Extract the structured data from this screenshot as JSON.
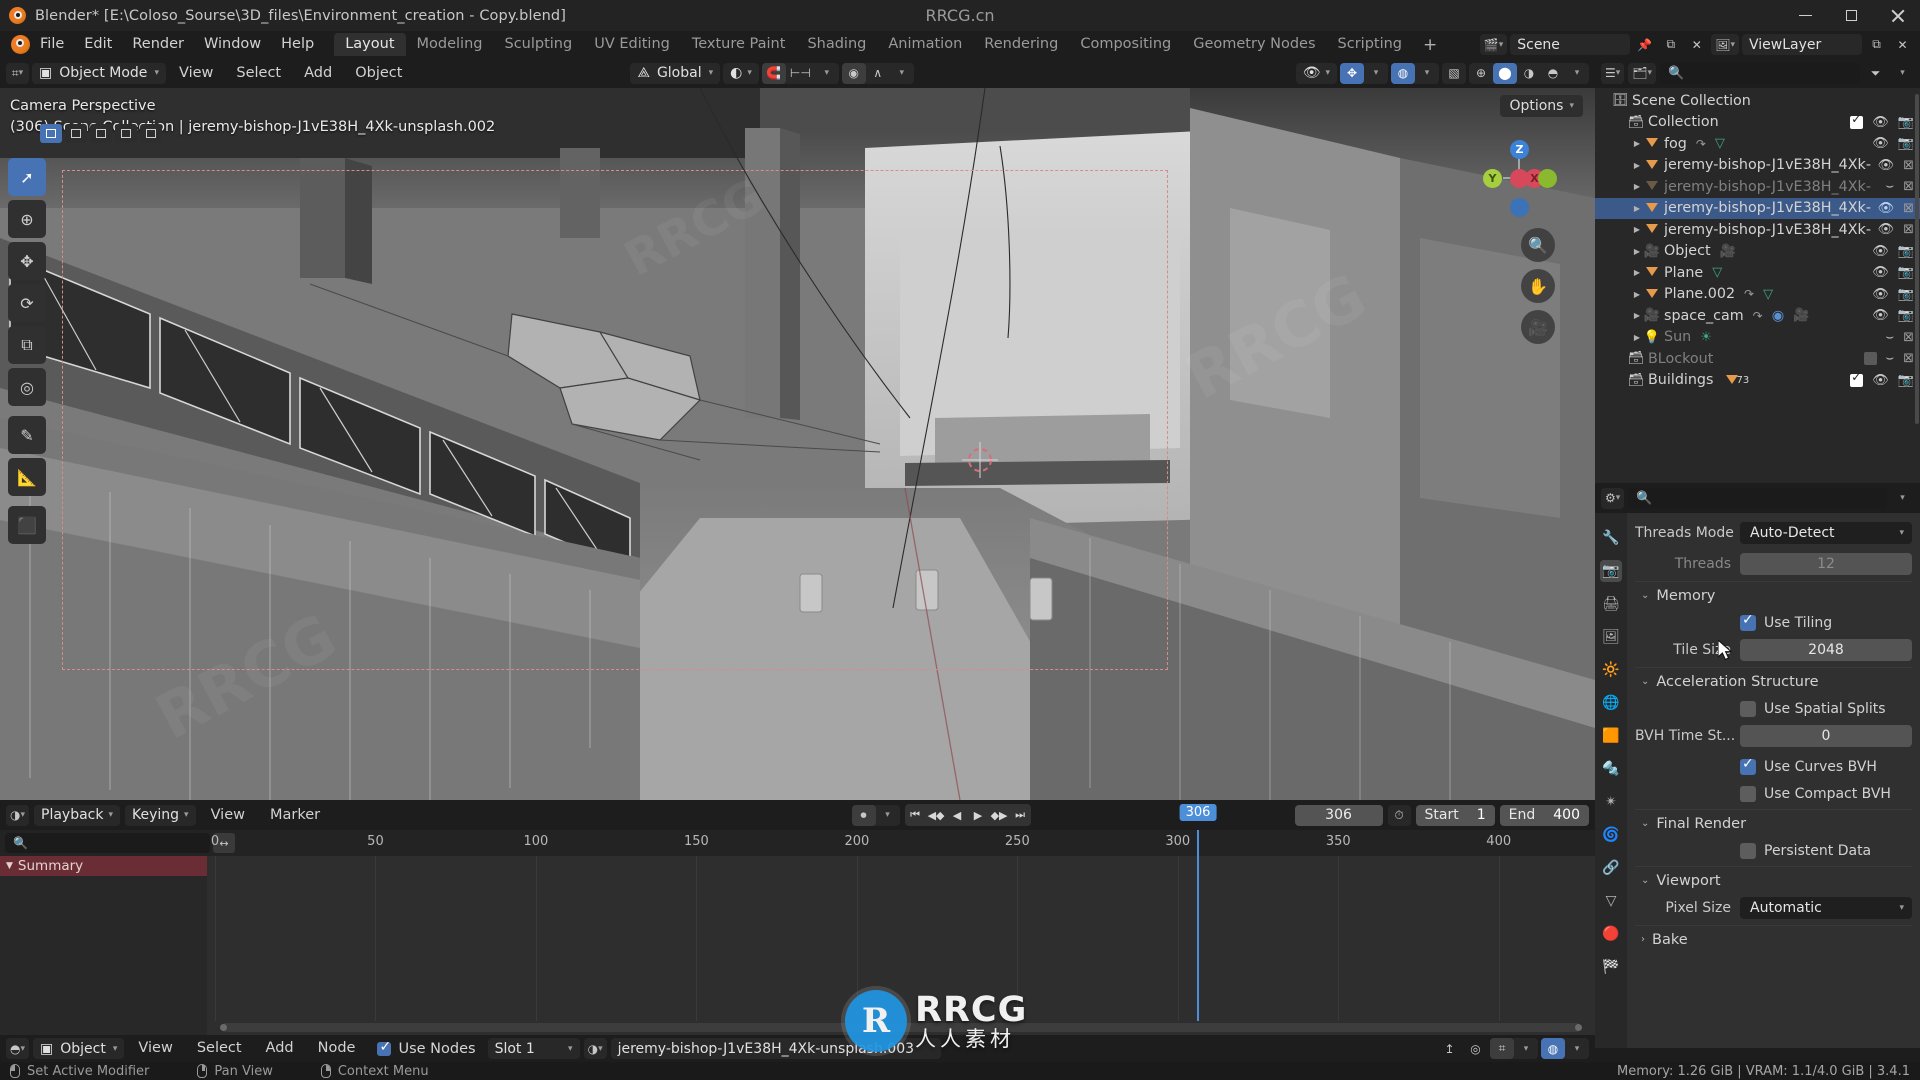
{
  "window": {
    "title": "Blender* [E:\\Coloso_Sourse\\3D_files\\Environment_creation - Copy.blend]",
    "center_watermark": "RRCG.cn",
    "minimize": "–",
    "maximize": "□",
    "close": "✕"
  },
  "menus": [
    "File",
    "Edit",
    "Render",
    "Window",
    "Help"
  ],
  "workspaces": {
    "tabs": [
      "Layout",
      "Modeling",
      "Sculpting",
      "UV Editing",
      "Texture Paint",
      "Shading",
      "Animation",
      "Rendering",
      "Compositing",
      "Geometry Nodes",
      "Scripting"
    ],
    "active": "Layout",
    "add": "+"
  },
  "topbar_right": {
    "scene_icon": "scene-icon",
    "scene_name": "Scene",
    "viewlayer_icon": "viewlayer-icon",
    "viewlayer_name": "ViewLayer"
  },
  "viewport": {
    "mode": "Object Mode",
    "menus": [
      "View",
      "Select",
      "Add",
      "Object"
    ],
    "transform_orientation": "Global",
    "options_label": "Options",
    "overlay_line1": "Camera Perspective",
    "overlay_line2": "(306) Scene Collection | jeremy-bishop-J1vE38H_4Xk-unsplash.002",
    "gizmo_axes": [
      "X",
      "Y",
      "Z"
    ]
  },
  "outliner": {
    "search_placeholder": "",
    "rows": [
      {
        "label": "Scene Collection",
        "icon": "scene-collection-icon",
        "indent": 0,
        "disclosure": false,
        "checkbox": null,
        "eye": false,
        "camera": false,
        "selected": false,
        "dim": false
      },
      {
        "label": "Collection",
        "icon": "collection-icon",
        "indent": 1,
        "disclosure": false,
        "checkbox": true,
        "eye": true,
        "camera": true,
        "selected": false,
        "dim": false
      },
      {
        "label": "fog",
        "icon": "mesh-object-icon",
        "indent": 2,
        "disclosure": true,
        "checkbox": null,
        "eye": true,
        "camera": true,
        "selected": false,
        "dim": false,
        "extra": [
          "modifier-icon",
          "mesh-data-icon"
        ]
      },
      {
        "label": "jeremy-bishop-J1vE38H_4Xk-",
        "icon": "mesh-object-icon",
        "indent": 2,
        "disclosure": true,
        "checkbox": null,
        "eye": true,
        "camera": "disabled",
        "selected": false,
        "dim": false
      },
      {
        "label": "jeremy-bishop-J1vE38H_4Xk-",
        "icon": "mesh-object-icon",
        "indent": 2,
        "disclosure": true,
        "checkbox": null,
        "eye": "closed",
        "camera": "disabled",
        "selected": false,
        "dim": true
      },
      {
        "label": "jeremy-bishop-J1vE38H_4Xk-",
        "icon": "mesh-object-icon",
        "indent": 2,
        "disclosure": true,
        "checkbox": null,
        "eye": true,
        "camera": "disabled",
        "selected": true,
        "dim": false
      },
      {
        "label": "jeremy-bishop-J1vE38H_4Xk-",
        "icon": "mesh-object-icon",
        "indent": 2,
        "disclosure": true,
        "checkbox": null,
        "eye": true,
        "camera": "disabled",
        "selected": false,
        "dim": false
      },
      {
        "label": "Object",
        "icon": "camera-object-icon",
        "indent": 2,
        "disclosure": true,
        "checkbox": null,
        "eye": true,
        "camera": true,
        "selected": false,
        "dim": false,
        "extra": [
          "camera-data-icon"
        ]
      },
      {
        "label": "Plane",
        "icon": "mesh-object-icon",
        "indent": 2,
        "disclosure": true,
        "checkbox": null,
        "eye": true,
        "camera": true,
        "selected": false,
        "dim": false,
        "extra": [
          "mesh-data-icon"
        ]
      },
      {
        "label": "Plane.002",
        "icon": "mesh-object-icon",
        "indent": 2,
        "disclosure": true,
        "checkbox": null,
        "eye": true,
        "camera": true,
        "selected": false,
        "dim": false,
        "extra": [
          "modifier-icon",
          "mesh-data-icon"
        ]
      },
      {
        "label": "space_cam",
        "icon": "camera-object-icon",
        "indent": 2,
        "disclosure": true,
        "checkbox": null,
        "eye": true,
        "camera": true,
        "selected": false,
        "dim": false,
        "extra": [
          "modifier-icon",
          "constraint-icon",
          "camera-data-icon"
        ]
      },
      {
        "label": "Sun",
        "icon": "light-object-icon",
        "indent": 2,
        "disclosure": true,
        "checkbox": null,
        "eye": "closed",
        "camera": "disabled",
        "selected": false,
        "dim": true,
        "extra": [
          "light-data-icon"
        ]
      },
      {
        "label": "BLockout",
        "icon": "collection-icon",
        "indent": 1,
        "disclosure": false,
        "checkbox": "off",
        "eye": "closed",
        "camera": "disabled",
        "selected": false,
        "dim": true
      },
      {
        "label": "Buildings",
        "icon": "collection-icon",
        "indent": 1,
        "disclosure": false,
        "checkbox": true,
        "eye": true,
        "camera": true,
        "selected": false,
        "dim": false,
        "count": "73"
      }
    ]
  },
  "properties": {
    "search_placeholder": "",
    "tabs": [
      "tool-icon",
      "render-icon",
      "output-icon",
      "viewlayer-icon",
      "scene-icon",
      "world-icon",
      "collection-icon",
      "object-icon",
      "modifier-icon",
      "particles-icon",
      "physics-icon",
      "constraint-icon",
      "data-icon",
      "material-icon",
      "texture-icon"
    ],
    "active_tab_index": 1,
    "performance": {
      "threads_mode_label": "Threads Mode",
      "threads_mode_value": "Auto-Detect",
      "threads_label": "Threads",
      "threads_value": "12"
    },
    "memory": {
      "section": "Memory",
      "use_tiling_label": "Use Tiling",
      "use_tiling_checked": true,
      "tile_size_label": "Tile Size",
      "tile_size_value": "2048"
    },
    "acceleration": {
      "section": "Acceleration Structure",
      "use_spatial_splits_label": "Use Spatial Splits",
      "use_spatial_splits_checked": false,
      "bvh_time_label": "BVH Time St...",
      "bvh_time_value": "0",
      "use_curves_bvh_label": "Use Curves BVH",
      "use_curves_bvh_checked": true,
      "use_compact_bvh_label": "Use Compact BVH",
      "use_compact_bvh_checked": false
    },
    "final_render": {
      "section": "Final Render",
      "persistent_data_label": "Persistent Data",
      "persistent_data_checked": false
    },
    "viewport_sect": {
      "section": "Viewport",
      "pixel_size_label": "Pixel Size",
      "pixel_size_value": "Automatic"
    },
    "bake": {
      "section": "Bake"
    }
  },
  "timeline": {
    "editor_icon": "timeline-icon",
    "menus": [
      "Playback",
      "Keying",
      "View",
      "Marker"
    ],
    "current_frame": "306",
    "start_label": "Start",
    "start_value": "1",
    "end_label": "End",
    "end_value": "400",
    "playhead_label": "306",
    "summary_label": "Summary",
    "ticks": [
      "0",
      "50",
      "100",
      "150",
      "200",
      "250",
      "300",
      "350",
      "400"
    ],
    "tick_values": [
      0,
      50,
      100,
      150,
      200,
      250,
      300,
      350,
      400
    ],
    "search_placeholder": ""
  },
  "shader_editor": {
    "editor_icon": "shader-editor-icon",
    "shader_type": "Object",
    "menus": [
      "View",
      "Select",
      "Add",
      "Node"
    ],
    "use_nodes_label": "Use Nodes",
    "use_nodes_checked": true,
    "slot": "Slot 1",
    "material_name": "jeremy-bishop-J1vE38H_4Xk-unsplash.003"
  },
  "statusbar": {
    "items": [
      {
        "mouse": "left",
        "label": "Set Active Modifier"
      },
      {
        "mouse": "middle",
        "label": "Pan View"
      },
      {
        "mouse": "right",
        "label": "Context Menu"
      }
    ],
    "stats": "Memory: 1.26 GiB | VRAM: 1.1/4.0 GiB | 3.4.1"
  },
  "watermark": {
    "brand": "RRCG",
    "sub": "人人素材",
    "mark": "R",
    "diag": "RRCG"
  },
  "colors": {
    "accent_blue": "#4772b3",
    "select_blue": "#3b5a89",
    "playhead": "#4c8fd8",
    "orange": "#e79a4a",
    "mesh_green": "#3fa882",
    "summary_red": "#6b2d35"
  }
}
